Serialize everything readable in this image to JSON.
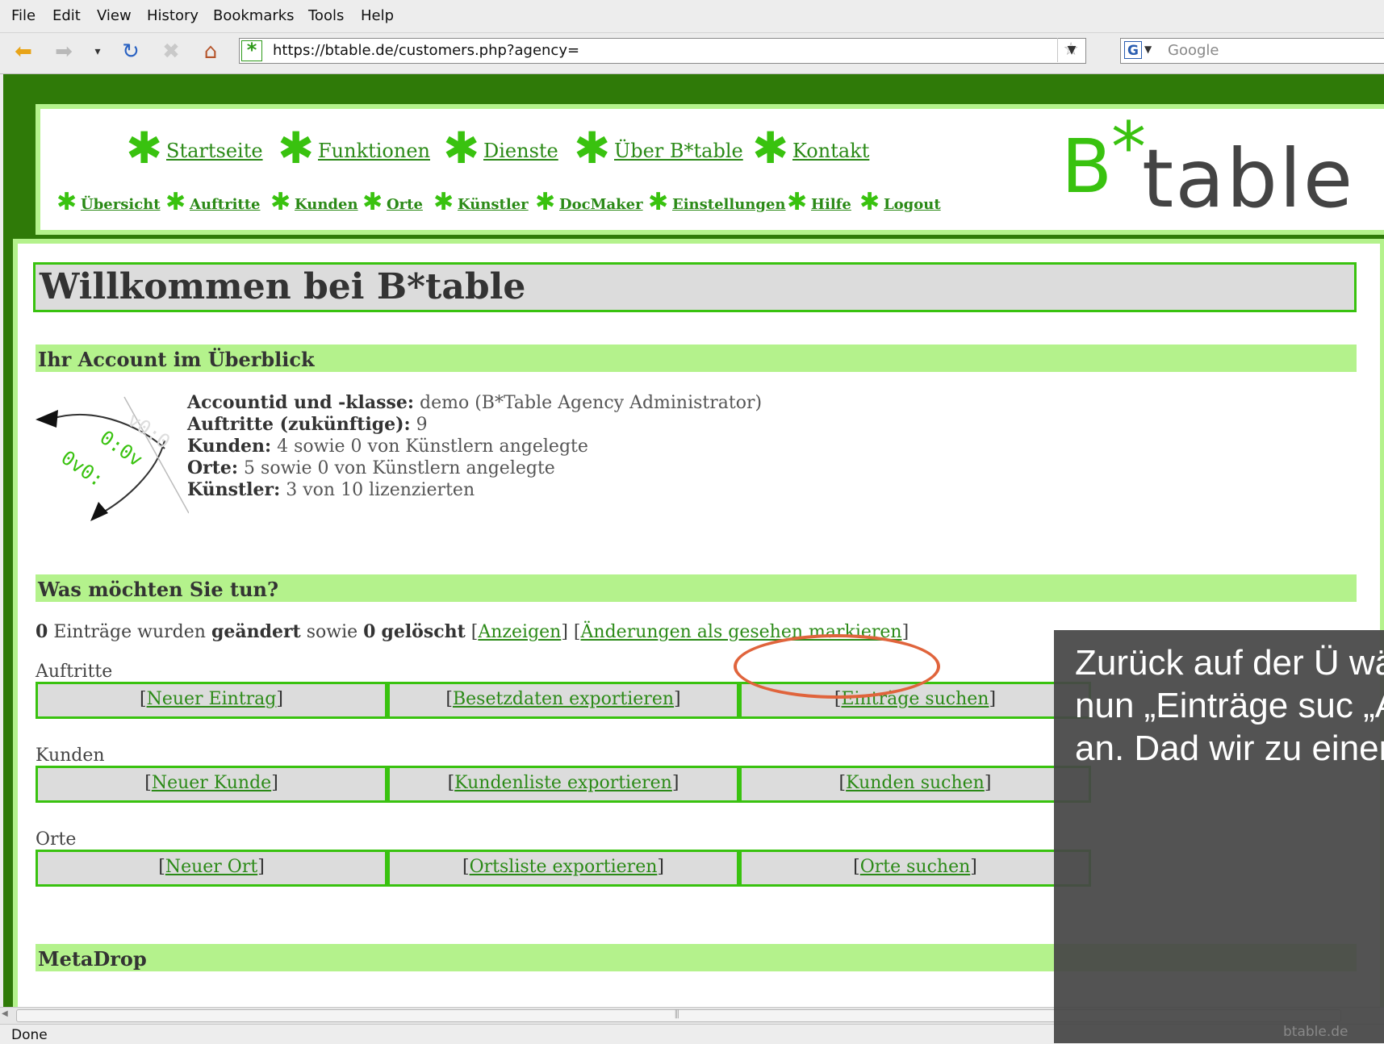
{
  "menu": [
    "File",
    "Edit",
    "View",
    "History",
    "Bookmarks",
    "Tools",
    "Help"
  ],
  "url": "https://btable.de/customers.php?agency=",
  "search_placeholder": "Google",
  "site": {
    "main_nav": [
      "Startseite",
      "Funktionen",
      "Dienste",
      "Über B*table",
      "Kontakt"
    ],
    "sub_nav": [
      "Übersicht",
      "Auftritte",
      "Kunden",
      "Orte",
      "Künstler",
      "DocMaker",
      "Einstellungen",
      "Hilfe",
      "Logout"
    ],
    "logo": {
      "b": "B",
      "star": "*",
      "table": "table"
    }
  },
  "page": {
    "title": "Willkommen bei B*table",
    "account_heading": "Ihr Account im Überblick",
    "account": [
      {
        "label": "Accountid und -klasse:",
        "value": "demo (B*Table Agency Administrator)"
      },
      {
        "label": "Auftritte (zukünftige):",
        "value": "9"
      },
      {
        "label": "Kunden:",
        "value": "4 sowie 0 von Künstlern angelegte"
      },
      {
        "label": "Orte:",
        "value": "5 sowie 0 von Künstlern angelegte"
      },
      {
        "label": "Künstler:",
        "value": "3 von 10 lizenzierten"
      }
    ],
    "todo_heading": "Was möchten Sie tun?",
    "changes": {
      "count_changed": "0",
      "t1": "Einträge wurden",
      "changed": "geändert",
      "t2": "sowie",
      "count_deleted": "0",
      "deleted": "gelöscht",
      "link_show": "Anzeigen",
      "link_mark": "Änderungen als gesehen markieren"
    },
    "groups": [
      {
        "label": "Auftritte",
        "actions": [
          "Neuer Eintrag",
          "Besetzdaten exportieren",
          "Einträge suchen"
        ]
      },
      {
        "label": "Kunden",
        "actions": [
          "Neuer Kunde",
          "Kundenliste exportieren",
          "Kunden suchen"
        ]
      },
      {
        "label": "Orte",
        "actions": [
          "Neuer Ort",
          "Ortsliste exportieren",
          "Orte suchen"
        ]
      }
    ],
    "metadrop_heading": "MetaDrop"
  },
  "status": {
    "text": "Done",
    "host": "btable.de"
  },
  "overlay_text": "Zurück auf der Ü wählen wir nun „Einträge suc „Auftritte“ an. Dad wir zu einer Suchn",
  "colors": {
    "site_dark": "#2f7a08",
    "site_light": "#b4f28c",
    "accent": "#39c20f",
    "highlight": "#e0643c"
  }
}
